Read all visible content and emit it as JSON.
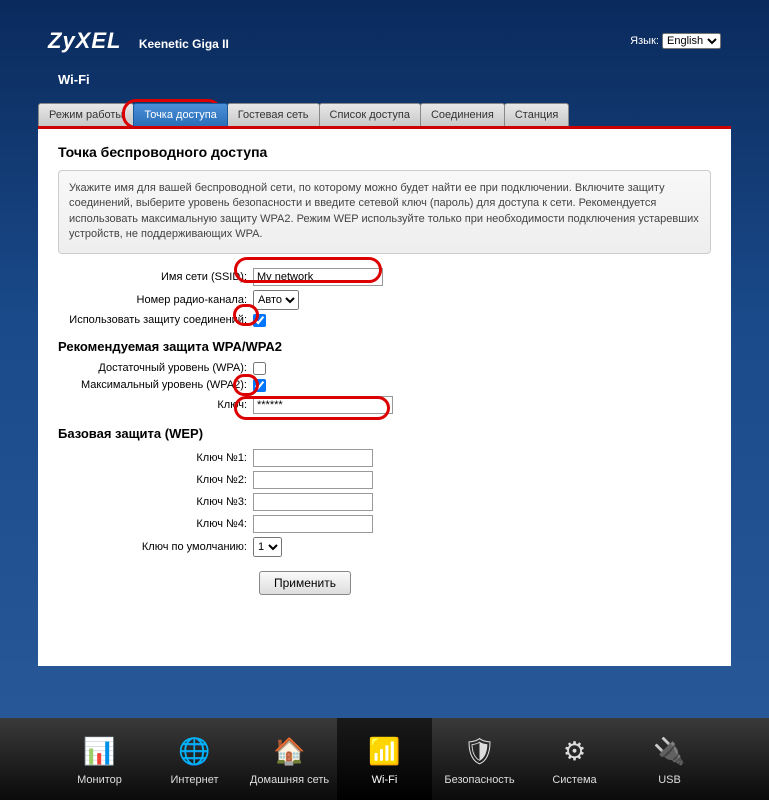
{
  "header": {
    "logo": "ZyXEL",
    "model": "Keenetic Giga II",
    "lang_label": "Язык:",
    "lang_value": "English"
  },
  "section_title": "Wi-Fi",
  "tabs": [
    {
      "label": "Режим работы"
    },
    {
      "label": "Точка доступа"
    },
    {
      "label": "Гостевая сеть"
    },
    {
      "label": "Список доступа"
    },
    {
      "label": "Соединения"
    },
    {
      "label": "Станция"
    }
  ],
  "content": {
    "title": "Точка беспроводного доступа",
    "info": "Укажите имя для вашей беспроводной сети, по которому можно будет найти ее при подключении. Включите защиту соединений, выберите уровень безопасности и введите сетевой ключ (пароль) для доступа к сети. Рекомендуется использовать максимальную защиту WPA2. Режим WEP используйте только при необходимости подключения устаревших устройств, не поддерживающих WPA.",
    "ssid_label": "Имя сети (SSID):",
    "ssid_value": "My network",
    "channel_label": "Номер радио-канала:",
    "channel_value": "Авто",
    "protect_label": "Использовать защиту соединений:",
    "protect_checked": true,
    "wpa_title": "Рекомендуемая защита WPA/WPA2",
    "wpa_label": "Достаточный уровень (WPA):",
    "wpa_checked": false,
    "wpa2_label": "Максимальный уровень (WPA2):",
    "wpa2_checked": true,
    "key_label": "Ключ:",
    "key_value": "******",
    "wep_title": "Базовая защита (WEP)",
    "wep_key1_label": "Ключ №1:",
    "wep_key2_label": "Ключ №2:",
    "wep_key3_label": "Ключ №3:",
    "wep_key4_label": "Ключ №4:",
    "wep_default_label": "Ключ по умолчанию:",
    "wep_default_value": "1",
    "apply_label": "Применить"
  },
  "nav": [
    {
      "label": "Монитор",
      "icon": "📊"
    },
    {
      "label": "Интернет",
      "icon": "🌐"
    },
    {
      "label": "Домашняя сеть",
      "icon": "🏠"
    },
    {
      "label": "Wi-Fi",
      "icon": "📶"
    },
    {
      "label": "Безопасность",
      "icon": "🛡"
    },
    {
      "label": "Система",
      "icon": "⚙"
    },
    {
      "label": "USB",
      "icon": "🔌"
    }
  ]
}
